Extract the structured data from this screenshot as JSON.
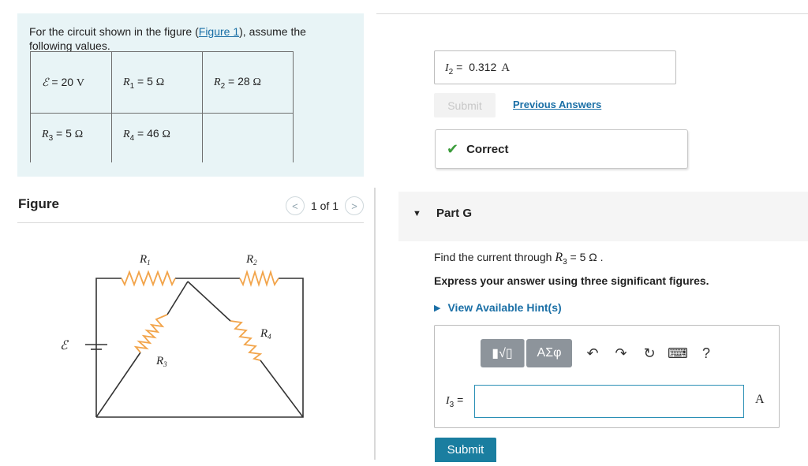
{
  "problem": {
    "text_before": "For the circuit shown in the figure (",
    "figure_link": "Figure 1",
    "text_after": "), assume the following values.",
    "values": [
      [
        {
          "sym": "ℰ",
          "sub": "",
          "eq": " = 20 ",
          "unit": "V"
        },
        {
          "sym": "R",
          "sub": "1",
          "eq": " = 5 ",
          "unit": "Ω"
        },
        {
          "sym": "R",
          "sub": "2",
          "eq": " = 28 ",
          "unit": "Ω"
        }
      ],
      [
        {
          "sym": "R",
          "sub": "3",
          "eq": " = 5 ",
          "unit": "Ω"
        },
        {
          "sym": "R",
          "sub": "4",
          "eq": " = 46 ",
          "unit": "Ω"
        },
        {
          "sym": "",
          "sub": "",
          "eq": "",
          "unit": ""
        }
      ]
    ]
  },
  "figure": {
    "title": "Figure",
    "pager_text": "1 of 1",
    "prev_icon": "chevron-left-icon",
    "next_icon": "chevron-right-icon",
    "labels": {
      "r1": "R",
      "r1_sub": "1",
      "r2": "R",
      "r2_sub": "2",
      "r3": "R",
      "r3_sub": "3",
      "r4": "R",
      "r4_sub": "4",
      "emf": "ℰ"
    }
  },
  "previous_part": {
    "answer_var": "I",
    "answer_sub": "2",
    "answer_eq": " = ",
    "answer_value": "0.312",
    "answer_unit": "A",
    "submit_label": "Submit",
    "previous_answers_label": "Previous Answers",
    "correct_label": "Correct"
  },
  "part_g": {
    "title": "Part G",
    "question_before": "Find the current through ",
    "question_var": "R",
    "question_sub": "3",
    "question_after": " = 5 Ω .",
    "instruction": "Express your answer using three significant figures.",
    "hints_label": "View Available Hint(s)",
    "toolbar": {
      "template_label": "▮√▯",
      "greek_label": "ΑΣφ",
      "undo_icon": "undo-icon",
      "redo_icon": "redo-icon",
      "reset_icon": "reset-icon",
      "keyboard_icon": "keyboard-icon",
      "help_label": "?"
    },
    "answer_var": "I",
    "answer_sub": "3",
    "answer_eq": " = ",
    "answer_input_value": "",
    "answer_unit": "A",
    "submit_label": "Submit"
  },
  "colors": {
    "accent": "#1a7ea0",
    "link": "#1a6fa6",
    "correct": "#3b9c3b",
    "resistor": "#f2a44a"
  }
}
